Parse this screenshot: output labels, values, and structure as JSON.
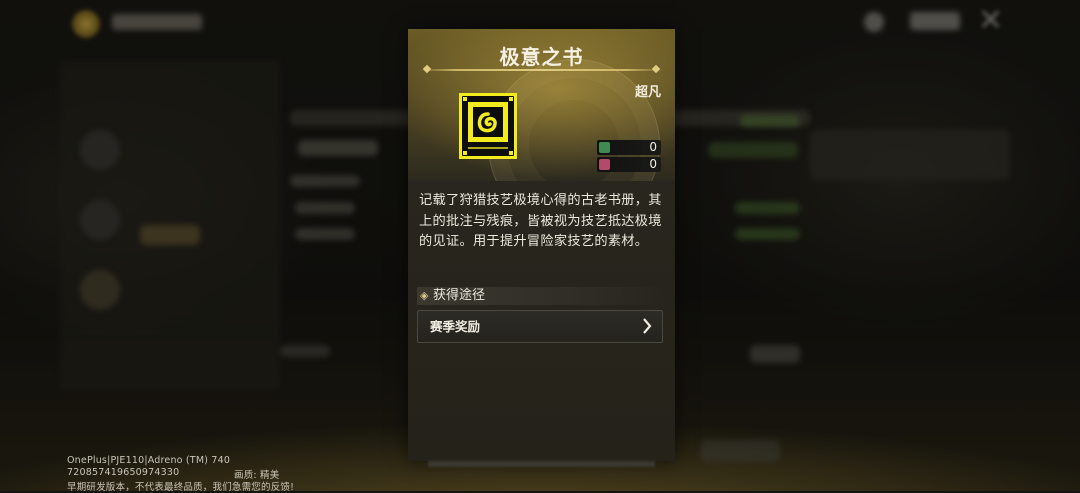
{
  "item": {
    "title": "极意之书",
    "rarity": "超凡",
    "description": "记载了狩猎技艺极境心得的古老书册，其上的批注与残痕，皆被视为技艺抵达极境的见证。用于提升冒险家技艺的素材。",
    "counters": [
      {
        "icon": "storage-icon",
        "value": "0",
        "color": "#3f8a52"
      },
      {
        "icon": "backpack-icon",
        "value": "0",
        "color": "#b24a6a"
      }
    ]
  },
  "acquisition": {
    "section_label": "获得途径",
    "sources": [
      {
        "label": "赛季奖励"
      }
    ]
  },
  "watermark": {
    "line1": "OnePlus|PJE110|Adreno (TM) 740",
    "line2_id": "720857419650974330",
    "line2_quality": "画质: 精美",
    "line3": "早期研发版本，不代表最终品质，我们急需您的反馈!"
  },
  "colors": {
    "accent_gold": "#cdb564",
    "book_yellow": "#f2ec1e"
  }
}
